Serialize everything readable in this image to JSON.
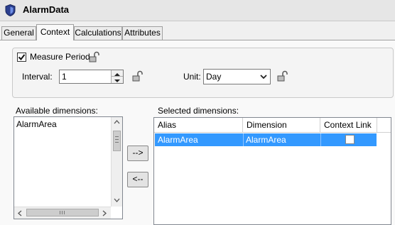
{
  "window": {
    "title": "AlarmData"
  },
  "tabs": [
    {
      "label": "General"
    },
    {
      "label": "Context",
      "active": true
    },
    {
      "label": "Calculations"
    },
    {
      "label": "Attributes"
    }
  ],
  "measure_period": {
    "label": "Measure Period",
    "checked": true,
    "interval_label": "Interval:",
    "interval_value": "1",
    "unit_label": "Unit:",
    "unit_value": "Day"
  },
  "available": {
    "label": "Available dimensions:",
    "items": [
      "AlarmArea"
    ]
  },
  "buttons": {
    "add": "-->",
    "remove": "<--"
  },
  "selected": {
    "label": "Selected dimensions:",
    "columns": [
      "Alias",
      "Dimension",
      "Context Link"
    ],
    "rows": [
      {
        "alias": "AlarmArea",
        "dimension": "AlarmArea",
        "context_link": false
      }
    ]
  },
  "colors": {
    "selection": "#3399ff"
  }
}
